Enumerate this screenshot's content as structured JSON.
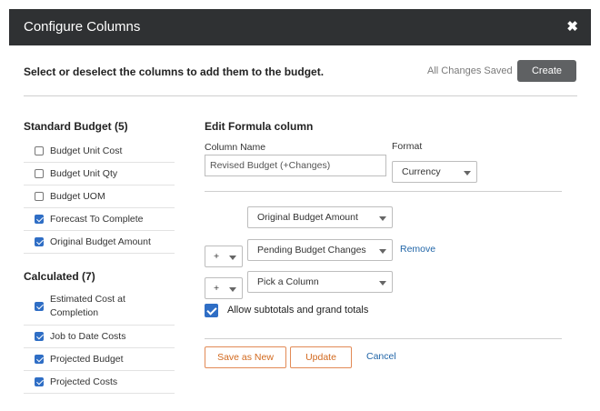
{
  "header": {
    "title": "Configure Columns",
    "close_icon": "close-icon"
  },
  "topbar": {
    "instruction": "Select or deselect the columns to add them to the budget.",
    "saved_status": "All Changes Saved",
    "create_label": "Create"
  },
  "standard": {
    "title": "Standard Budget (5)",
    "items": [
      {
        "label": "Budget Unit Cost",
        "checked": false
      },
      {
        "label": "Budget Unit Qty",
        "checked": false
      },
      {
        "label": "Budget UOM",
        "checked": false
      },
      {
        "label": "Forecast To Complete",
        "checked": true
      },
      {
        "label": "Original Budget Amount",
        "checked": true
      }
    ]
  },
  "calculated": {
    "title": "Calculated (7)",
    "items": [
      {
        "label": "Estimated Cost at Completion",
        "checked": true
      },
      {
        "label": "Job to Date Costs",
        "checked": true
      },
      {
        "label": "Projected Budget",
        "checked": true
      },
      {
        "label": "Projected Costs",
        "checked": true
      }
    ]
  },
  "editor": {
    "title": "Edit Formula column",
    "column_name_label": "Column Name",
    "column_name_value": "Revised Budget (+Changes)",
    "format_label": "Format",
    "format_value": "Currency",
    "rows": [
      {
        "operator": "",
        "column": "Original Budget Amount"
      },
      {
        "operator": "+",
        "column": "Pending Budget Changes"
      },
      {
        "operator": "+",
        "column": "Pick a Column"
      }
    ],
    "remove_label": "Remove",
    "subtotals_label": "Allow subtotals and grand totals",
    "subtotals_checked": true,
    "save_as_new_label": "Save as New",
    "update_label": "Update",
    "cancel_label": "Cancel"
  }
}
